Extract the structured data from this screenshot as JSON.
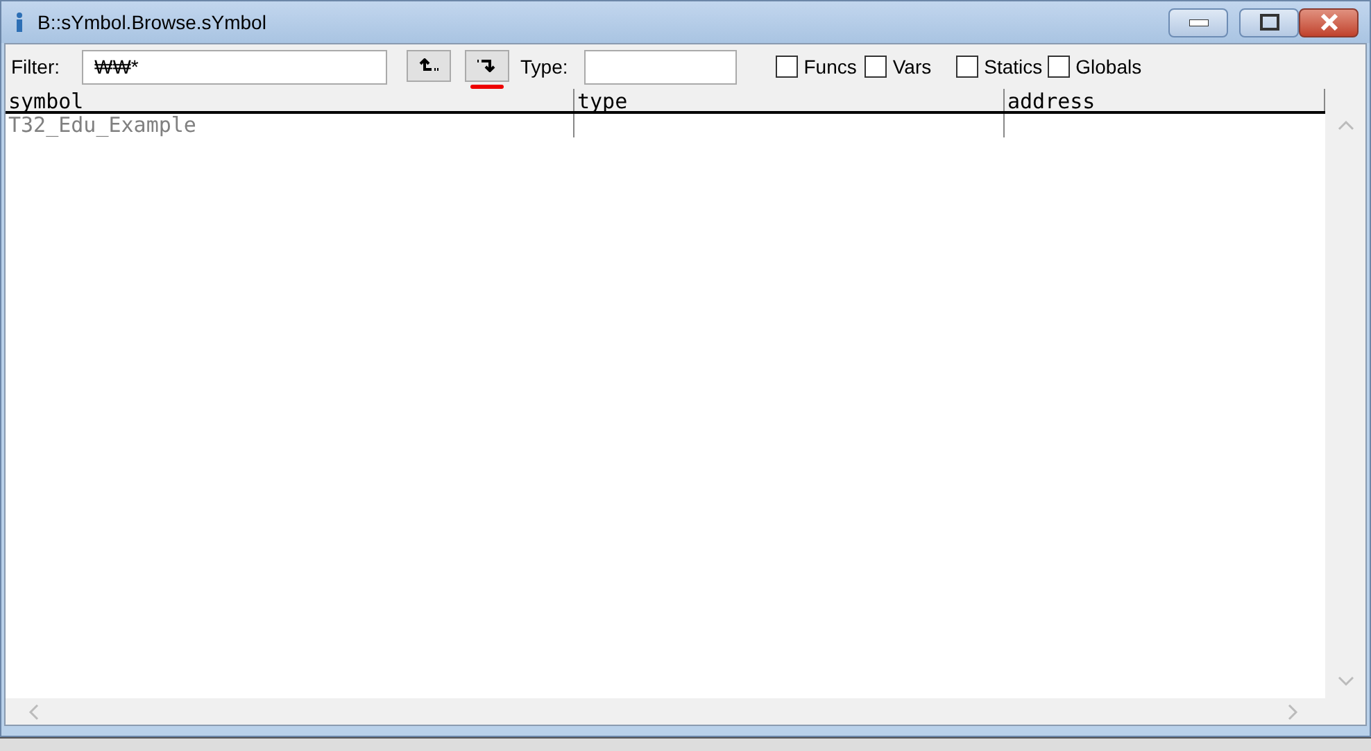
{
  "window": {
    "title": "B::sYmbol.Browse.sYmbol"
  },
  "filter": {
    "label": "Filter:",
    "value": "₩₩*"
  },
  "sort_buttons": [
    {
      "kind": "up",
      "selected": false
    },
    {
      "kind": "down",
      "selected": true
    }
  ],
  "type_field": {
    "label": "Type:"
  },
  "checkboxes": [
    {
      "label": "Funcs",
      "checked": false
    },
    {
      "label": "Vars",
      "checked": false
    },
    {
      "label": "Statics",
      "checked": false
    },
    {
      "label": "Globals",
      "checked": false
    }
  ],
  "table": {
    "columns": [
      "symbol",
      "type",
      "address"
    ],
    "rows": [
      [
        "T32_Edu_Example",
        "",
        ""
      ]
    ]
  }
}
